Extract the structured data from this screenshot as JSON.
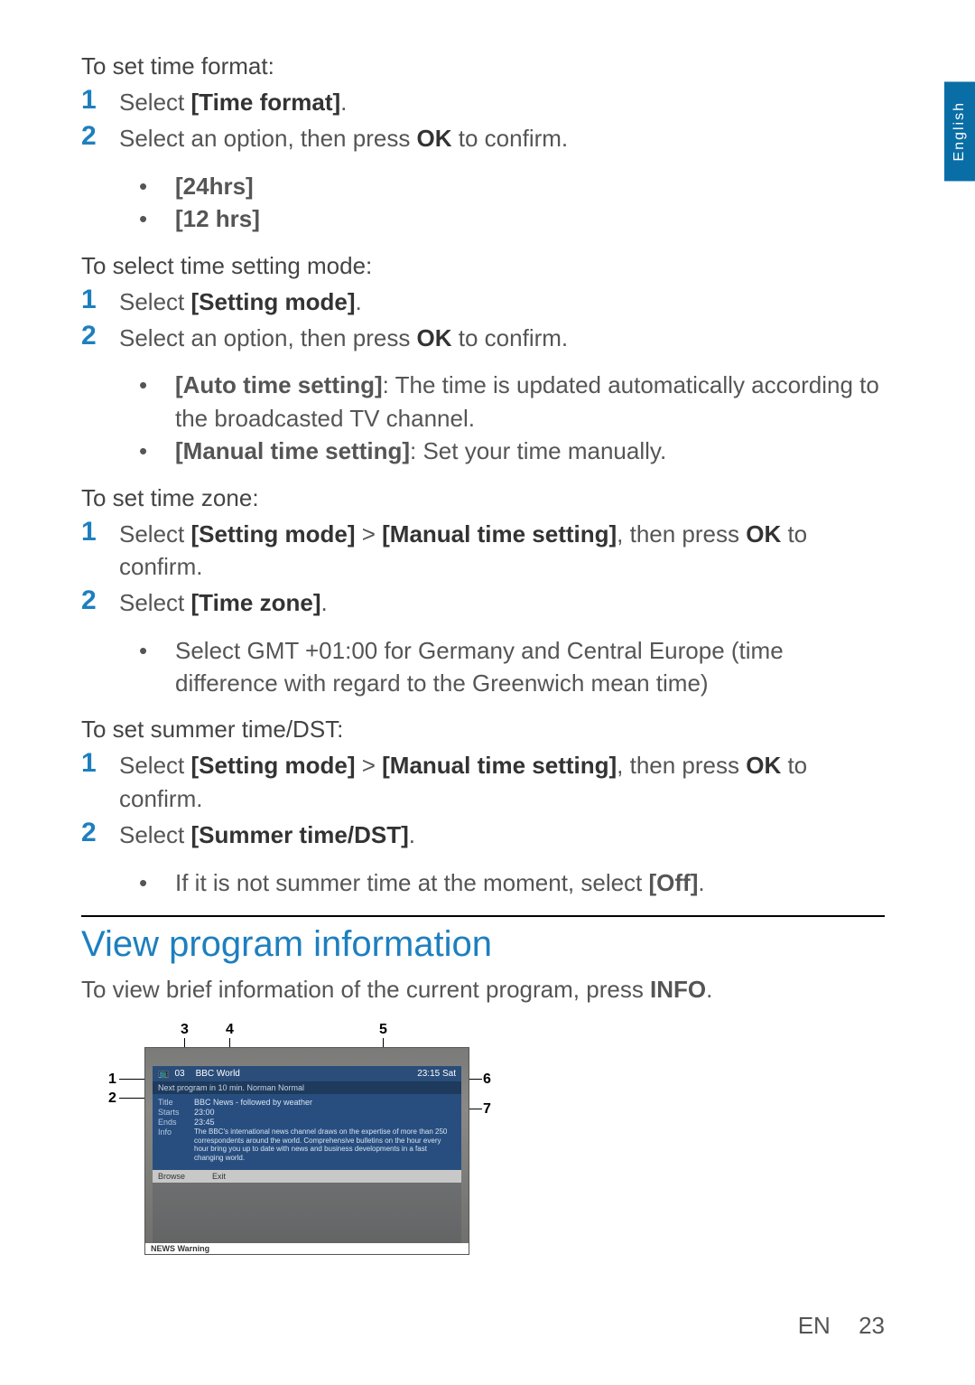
{
  "lang_tab": "English",
  "sections": {
    "time_format": {
      "intro": "To set time format:",
      "step1_pre": "Select ",
      "step1_bold": "[Time format]",
      "step1_post": ".",
      "step2_pre": "Select an option, then press ",
      "step2_bold": "OK",
      "step2_post": " to confirm.",
      "bullet1": "[24hrs]",
      "bullet2": "[12 hrs]"
    },
    "setting_mode": {
      "intro": "To select time setting mode:",
      "step1_pre": "Select ",
      "step1_bold": "[Setting mode]",
      "step1_post": ".",
      "step2_pre": "Select an option, then press ",
      "step2_bold": "OK",
      "step2_post": " to confirm.",
      "bullet1_bold": "[Auto time setting]",
      "bullet1_rest": ": The time is updated automatically according to the broadcasted TV channel.",
      "bullet2_bold": "[Manual time setting]",
      "bullet2_rest": ": Set your time manually."
    },
    "time_zone": {
      "intro": "To set time zone:",
      "step1_pre": "Select ",
      "step1_b1": "[Setting mode]",
      "step1_mid": " > ",
      "step1_b2": "[Manual time setting]",
      "step1_mid2": ", then press ",
      "step1_b3": "OK",
      "step1_post": " to confirm.",
      "step2_pre": "Select ",
      "step2_bold": "[Time zone]",
      "step2_post": ".",
      "bullet1": "Select GMT +01:00 for Germany and Central Europe (time difference with regard to the Greenwich mean time)"
    },
    "dst": {
      "intro": "To set summer time/DST:",
      "step1_pre": "Select ",
      "step1_b1": "[Setting mode]",
      "step1_mid": " > ",
      "step1_b2": "[Manual time setting]",
      "step1_mid2": ", then press ",
      "step1_b3": "OK",
      "step1_post": " to confirm.",
      "step2_pre": "Select ",
      "step2_bold": "[Summer time/DST]",
      "step2_post": ".",
      "bullet1_pre": "If it is not summer time at the moment, select ",
      "bullet1_bold": "[Off]",
      "bullet1_post": "."
    }
  },
  "heading": "View program information",
  "para_pre": "To view brief information of the current program, press ",
  "para_bold": "INFO",
  "para_post": ".",
  "callouts": {
    "c1": "1",
    "c2": "2",
    "c3": "3",
    "c4": "4",
    "c5": "5",
    "c6": "6",
    "c7": "7"
  },
  "osd": {
    "ch_icon": "📺",
    "ch_num": "03",
    "ch_name": "BBC World",
    "clock": "23:15  Sat",
    "next": "Next program in 10 min. Norman Normal",
    "title_label": "Title",
    "title_val": "BBC News - followed by weather",
    "starts_label": "Starts",
    "starts_val": "23:00",
    "ends_label": "Ends",
    "ends_val": "23:45",
    "info_label": "Info",
    "info_val": "The BBC's international news channel draws on the expertise of more than 250 correspondents around the world. Comprehensive bulletins on the hour every hour bring you up to date with news and business developments in a fast changing world.",
    "footer_browse": "Browse",
    "footer_exit": "Exit",
    "news_strip": "NEWS   Warning"
  },
  "footer": {
    "lang": "EN",
    "page": "23"
  }
}
